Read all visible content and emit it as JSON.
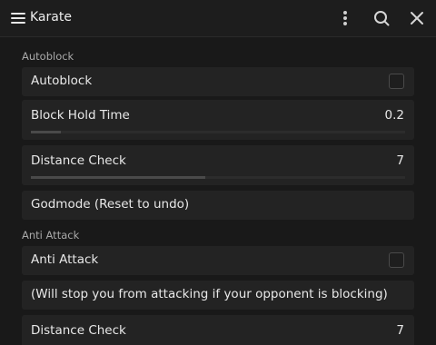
{
  "window": {
    "title": "Karate"
  },
  "sections": {
    "autoblock": {
      "label": "Autoblock",
      "autoblock_toggle": {
        "label": "Autoblock",
        "checked": false
      },
      "block_hold_time": {
        "label": "Block Hold Time",
        "value": "0.2",
        "fill_fraction": 0.08
      },
      "distance_check": {
        "label": "Distance Check",
        "value": "7",
        "fill_fraction": 0.465
      },
      "godmode_button": {
        "label": "Godmode (Reset to undo)"
      }
    },
    "anti_attack": {
      "label": "Anti Attack",
      "anti_attack_toggle": {
        "label": "Anti Attack",
        "checked": false
      },
      "info_text": "(Will stop you from attacking if your opponent is blocking)",
      "distance_check": {
        "label": "Distance Check",
        "value": "7",
        "fill_fraction": 0.465
      }
    }
  },
  "icons": [
    "hamburger-menu-icon",
    "kebab-menu-icon",
    "search-icon",
    "close-icon"
  ],
  "colors": {
    "background": "#191919",
    "row": "#232323",
    "text": "#e8e8e8",
    "section_label": "#a9a9a9"
  }
}
